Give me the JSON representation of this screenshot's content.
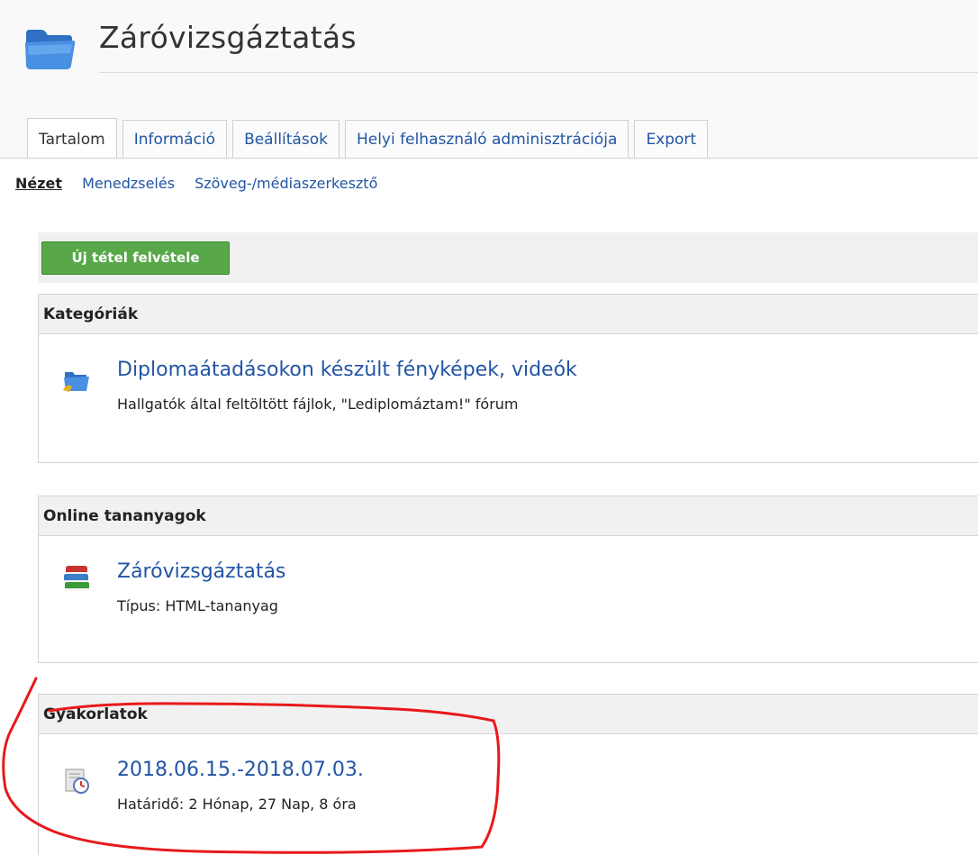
{
  "header": {
    "title": "Záróvizsgáztatás"
  },
  "tabs": [
    {
      "label": "Tartalom",
      "active": true
    },
    {
      "label": "Információ",
      "active": false
    },
    {
      "label": "Beállítások",
      "active": false
    },
    {
      "label": "Helyi felhasználó adminisztrációja",
      "active": false
    },
    {
      "label": "Export",
      "active": false
    }
  ],
  "subtabs": [
    {
      "label": "Nézet",
      "active": true
    },
    {
      "label": "Menedzselés",
      "active": false
    },
    {
      "label": "Szöveg-/médiaszerkesztő",
      "active": false
    }
  ],
  "toolbar": {
    "new_item_label": "Új tétel felvétele"
  },
  "blocks": {
    "categories": {
      "title": "Kategóriák",
      "item": {
        "title": "Diplomaátadásokon készült fényképek, videók",
        "description": "Hallgatók által feltöltött fájlok, \"Lediplomáztam!\" fórum"
      }
    },
    "online": {
      "title": "Online tananyagok",
      "item": {
        "title": "Záróvizsgáztatás",
        "description": "Típus: HTML-tananyag"
      }
    },
    "exercises": {
      "title": "Gyakorlatok",
      "item": {
        "title": "2018.06.15.-2018.07.03.",
        "description": "Határidő: 2 Hónap, 27 Nap, 8 óra"
      }
    }
  },
  "colors": {
    "link": "#2255a4",
    "button_green": "#58a849",
    "annotation_red": "#e8191a"
  }
}
